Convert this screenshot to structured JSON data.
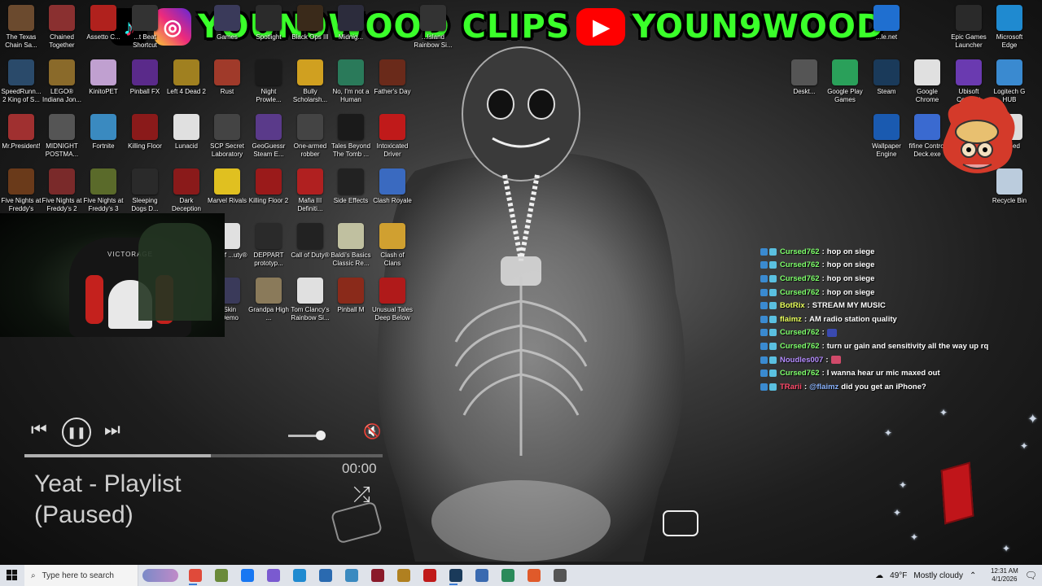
{
  "banner": {
    "icons": [
      "tiktok-icon",
      "instagram-icon",
      "youtube-icon"
    ],
    "text1": "YOUN9WOOD CLIPS",
    "text2": "YOUN9WOOD",
    "text_color": "#3aff2a"
  },
  "desktop_icons": [
    {
      "label": "The Texas Chain Sa...",
      "color": "#6b4a2e"
    },
    {
      "label": "Chained Together",
      "color": "#8a3030"
    },
    {
      "label": "Assetto C...",
      "color": "#b0211d"
    },
    {
      "label": "...t Beat Shortcut",
      "color": "#333"
    },
    {
      "label": "Games",
      "color": "#3a3a5a"
    },
    {
      "label": "Spotlight",
      "color": "#2b2b2b"
    },
    {
      "label": "Black Ops III",
      "color": "#3a2a1a"
    },
    {
      "label": "Midnig...",
      "color": "#2c2c3c"
    },
    {
      "label": "...Island Rainbow Si...",
      "color": "#333"
    },
    {
      "label": "SpeedRunn... 2 King of S...",
      "color": "#2a4a6a"
    },
    {
      "label": "LEGO® Indiana Jon...",
      "color": "#8a6a2a"
    },
    {
      "label": "KinitoPET",
      "color": "#c0a0d0"
    },
    {
      "label": "Pinball FX",
      "color": "#5a2a8a"
    },
    {
      "label": "Left 4 Dead 2",
      "color": "#a08020"
    },
    {
      "label": "Rust",
      "color": "#a03a2a"
    },
    {
      "label": "Night Prowle...",
      "color": "#1a1a1a"
    },
    {
      "label": "Bully Scholarsh...",
      "color": "#d0a020"
    },
    {
      "label": "No, I'm not a Human",
      "color": "#2a7a5a"
    },
    {
      "label": "Father's Day",
      "color": "#6a2a1a"
    },
    {
      "label": "Mr.President!",
      "color": "#a03030"
    },
    {
      "label": "MIDNIGHT POSTMA...",
      "color": "#555"
    },
    {
      "label": "Fortnite",
      "color": "#3a8ac0"
    },
    {
      "label": "Killing Floor",
      "color": "#8a1a1a"
    },
    {
      "label": "Lunacid",
      "color": "#e0e0e0"
    },
    {
      "label": "SCP Secret Laboratory",
      "color": "#444"
    },
    {
      "label": "GeoGuessr Steam E...",
      "color": "#5a3a8a"
    },
    {
      "label": "One-armed robber",
      "color": "#444"
    },
    {
      "label": "Tales Beyond The Tomb ...",
      "color": "#1a1a1a"
    },
    {
      "label": "Intoxicated Driver",
      "color": "#c01a1a"
    },
    {
      "label": "Five Nights at Freddy's",
      "color": "#6a3a1a"
    },
    {
      "label": "Five Nights at Freddy's 2",
      "color": "#7a2a2a"
    },
    {
      "label": "Five Nights at Freddy's 3",
      "color": "#5a6a2a"
    },
    {
      "label": "Sleeping Dogs D...",
      "color": "#2a2a2a"
    },
    {
      "label": "Dark Deception",
      "color": "#8a1a1a"
    },
    {
      "label": "Marvel Rivals",
      "color": "#e0c020"
    },
    {
      "label": "Killing Floor 2",
      "color": "#9a1a1a"
    },
    {
      "label": "Mafia III Definiti...",
      "color": "#b02020"
    },
    {
      "label": "Side Effects",
      "color": "#222"
    },
    {
      "label": "Clash Royale",
      "color": "#3a6ac0"
    },
    {
      "label": "...all of ...uty®",
      "color": "#e0e0e0"
    },
    {
      "label": "DEPPART prototyp...",
      "color": "#2a2a2a"
    },
    {
      "label": "Call of Duty®",
      "color": "#222"
    },
    {
      "label": "Baldi's Basics Classic Re...",
      "color": "#c0c0a0"
    },
    {
      "label": "Clash of Clans",
      "color": "#d0a030"
    },
    {
      "label": "...Skin ...Demo",
      "color": "#3a3a5a"
    },
    {
      "label": "Grandpa High ...",
      "color": "#8a7a5a"
    },
    {
      "label": "Tom Clancy's Rainbow Si...",
      "color": "#e0e0e0"
    },
    {
      "label": "Pinball M",
      "color": "#8a2a1a"
    },
    {
      "label": "Unusual Tales Deep Below",
      "color": "#b01a1a"
    }
  ],
  "right_icons": [
    {
      "label": "...le.net",
      "color": "#1f6fd0"
    },
    {
      "label": "Epic Games Launcher",
      "color": "#2a2a2a"
    },
    {
      "label": "Microsoft Edge",
      "color": "#1f8ad0"
    },
    {
      "label": "Deskt...",
      "color": "#555"
    },
    {
      "label": "Google Play Games",
      "color": "#2aa05a"
    },
    {
      "label": "Steam",
      "color": "#1a3a5a"
    },
    {
      "label": "Google Chrome",
      "color": "#e0e0e0"
    },
    {
      "label": "Ubisoft Connect",
      "color": "#6a3ab0"
    },
    {
      "label": "Logitech G HUB",
      "color": "#3a8ad0"
    },
    {
      "label": "Wallpaper Engine",
      "color": "#1a5ab0"
    },
    {
      "label": "fifine Control Deck.exe",
      "color": "#3a6ad0"
    },
    {
      "label": "untitled",
      "color": "#ddd"
    },
    {
      "label": "Recycle Bin",
      "color": "#bcd"
    }
  ],
  "player": {
    "song_title": "Yeat - Playlist",
    "status": "(Paused)",
    "time": "00:00",
    "progress": 0.52,
    "volume": 0.85
  },
  "chat": [
    {
      "user": "Cursed762",
      "user_color": "#7dff6a",
      "msg": "hop on siege"
    },
    {
      "user": "Cursed762",
      "user_color": "#7dff6a",
      "msg": "hop on siege"
    },
    {
      "user": "Cursed762",
      "user_color": "#7dff6a",
      "msg": "hop on siege"
    },
    {
      "user": "Cursed762",
      "user_color": "#7dff6a",
      "msg": "hop on siege"
    },
    {
      "user": "BotRix",
      "user_color": "#e8ff5a",
      "msg": "STREAM MY MUSIC"
    },
    {
      "user": "flaimz",
      "user_color": "#e8ff5a",
      "msg": "AM radio station quality"
    },
    {
      "user": "Cursed762",
      "user_color": "#7dff6a",
      "msg": ""
    },
    {
      "user": "Cursed762",
      "user_color": "#7dff6a",
      "msg": "turn ur gain and sensitivity all the way up rq"
    },
    {
      "user": "Noudles007",
      "user_color": "#b48cff",
      "msg": ""
    },
    {
      "user": "Cursed762",
      "user_color": "#7dff6a",
      "msg": "I wanna hear ur mic maxed out"
    },
    {
      "user": "TRarii",
      "user_color": "#ff4a6a",
      "msg": "did you get an iPhone?",
      "mention": "@flaimz"
    }
  ],
  "taskbar": {
    "search_placeholder": "Type here to search",
    "weather_temp": "49°F",
    "weather_desc": "Mostly cloudy",
    "time": "12:31 AM",
    "date": "4/1/2026",
    "apps": [
      {
        "name": "chrome-icon",
        "color": "#e04a3a"
      },
      {
        "name": "minecraft-icon",
        "color": "#6a8a3a"
      },
      {
        "name": "facebook-icon",
        "color": "#1877f2"
      },
      {
        "name": "copilot-icon",
        "color": "#7a5ad0"
      },
      {
        "name": "edge-icon",
        "color": "#1f8ad0"
      },
      {
        "name": "store-icon",
        "color": "#2a6ab0"
      },
      {
        "name": "maps-icon",
        "color": "#3a8ac0"
      },
      {
        "name": "app-icon",
        "color": "#8a1a2a"
      },
      {
        "name": "files-icon",
        "color": "#b08020"
      },
      {
        "name": "game-icon",
        "color": "#c01a1a"
      },
      {
        "name": "steam-icon",
        "color": "#1a3a5a"
      },
      {
        "name": "window-icon",
        "color": "#3a6ab0"
      },
      {
        "name": "phone-link-icon",
        "color": "#2a8a5a"
      },
      {
        "name": "brave-icon",
        "color": "#e05a2a"
      },
      {
        "name": "settings-icon",
        "color": "#555"
      }
    ]
  }
}
